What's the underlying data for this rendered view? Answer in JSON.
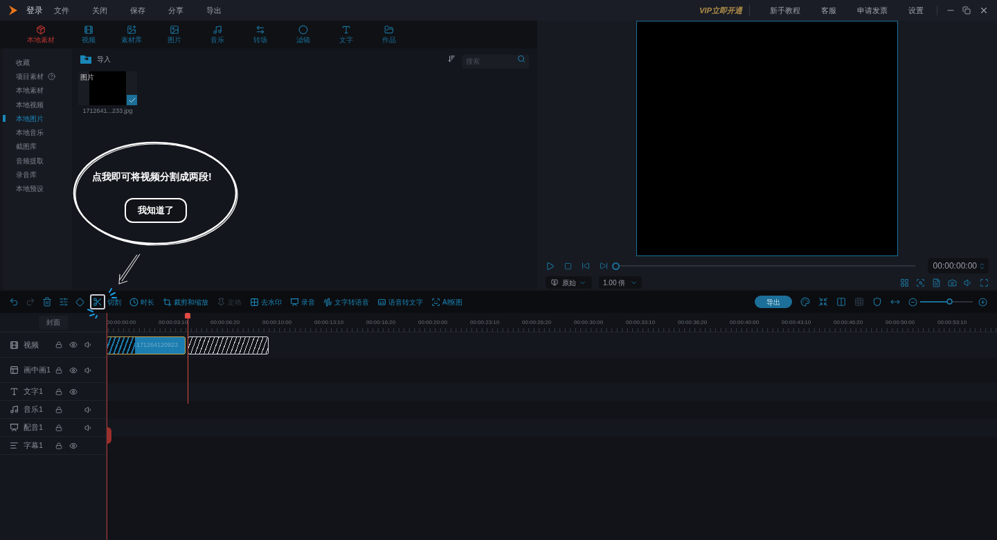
{
  "title_bar": {
    "login": "登录",
    "menu": [
      "文件",
      "关闭",
      "保存",
      "分享",
      "导出"
    ],
    "links": [
      {
        "label": "VIP立即开通",
        "kind": "vip"
      },
      {
        "label": "新手教程",
        "kind": "link"
      },
      {
        "label": "客服",
        "kind": "link"
      },
      {
        "label": "申请发票",
        "kind": "link"
      },
      {
        "label": "设置",
        "kind": "link"
      }
    ]
  },
  "media_tabs": [
    {
      "label": "本地素材",
      "kind": "box",
      "selected": true
    },
    {
      "label": "视频",
      "kind": "film",
      "selected": false
    },
    {
      "label": "素材库",
      "kind": "library",
      "selected": false
    },
    {
      "label": "图片",
      "kind": "image",
      "selected": false
    },
    {
      "label": "音乐",
      "kind": "music",
      "selected": false
    },
    {
      "label": "转场",
      "kind": "transition",
      "selected": false
    },
    {
      "label": "滤镜",
      "kind": "filter",
      "selected": false
    },
    {
      "label": "文字",
      "kind": "text",
      "selected": false
    },
    {
      "label": "作品",
      "kind": "folder",
      "selected": false
    }
  ],
  "sidebar": {
    "items": [
      {
        "label": "收藏",
        "help": false,
        "selected": false
      },
      {
        "label": "项目素材",
        "help": true,
        "selected": false
      },
      {
        "label": "本地素材",
        "help": false,
        "selected": false
      },
      {
        "label": "本地视频",
        "help": false,
        "selected": false
      },
      {
        "label": "本地图片",
        "help": false,
        "selected": true
      },
      {
        "label": "本地音乐",
        "help": false,
        "selected": false
      },
      {
        "label": "截图库",
        "help": false,
        "selected": false
      },
      {
        "label": "音频提取",
        "help": false,
        "selected": false
      },
      {
        "label": "录音库",
        "help": false,
        "selected": false
      },
      {
        "label": "本地预设",
        "help": false,
        "selected": false
      }
    ]
  },
  "library": {
    "import_label": "导入",
    "search": {
      "placeholder": "搜索"
    },
    "items": [
      {
        "badge": "图片",
        "filename": "1712641...233.jpg",
        "checked": true
      }
    ]
  },
  "tooltip": {
    "message": "点我即可将视频分割成两段!",
    "button": "我知道了"
  },
  "preview": {
    "progress": {
      "level": 0
    },
    "time": "00:00:00:00",
    "ratio": "原始",
    "speed": "1.00 倍"
  },
  "toolbar": {
    "tools": [
      {
        "label": "切割",
        "kind": "cut",
        "disabled": false,
        "highlighted": true
      },
      {
        "label": "时长",
        "kind": "clock",
        "disabled": false,
        "highlighted": false
      },
      {
        "label": "裁剪和缩放",
        "kind": "crop",
        "disabled": false,
        "highlighted": false
      },
      {
        "label": "定格",
        "kind": "freeze",
        "disabled": true,
        "highlighted": false
      },
      {
        "label": "去水印",
        "kind": "watermark",
        "disabled": false,
        "highlighted": false
      },
      {
        "label": "录音",
        "kind": "record",
        "disabled": false,
        "highlighted": false
      },
      {
        "label": "文字转语音",
        "kind": "tts",
        "disabled": false,
        "highlighted": false
      },
      {
        "label": "语音转文字",
        "kind": "stt",
        "disabled": false,
        "highlighted": false
      },
      {
        "label": "AI抠图",
        "kind": "ai",
        "disabled": false,
        "highlighted": false
      }
    ],
    "export": "导出",
    "zoom": {
      "level": 0.55
    }
  },
  "timeline": {
    "cover": "封面",
    "ticks": [
      "00:00:00:00",
      "00:00:03:10",
      "00:00:06:20",
      "00:00:10:00",
      "00:00:13:10",
      "00:00:16:20",
      "00:00:20:00",
      "00:00:23:10",
      "00:00:26:20",
      "00:00:30:00",
      "00:00:33:10",
      "00:00:36:20",
      "00:00:40:00",
      "00:00:43:10",
      "00:00:46:20",
      "00:00:50:00",
      "00:00:53:10"
    ],
    "tracks": [
      {
        "name": "视频",
        "kind": "film",
        "eye": true,
        "audio": true
      },
      {
        "name": "画中画1",
        "kind": "pip",
        "eye": true,
        "audio": true
      },
      {
        "name": "文字1",
        "kind": "text",
        "eye": true,
        "audio": false
      },
      {
        "name": "音乐1",
        "kind": "music",
        "eye": false,
        "audio": true
      },
      {
        "name": "配音1",
        "kind": "dub",
        "eye": false,
        "audio": true
      },
      {
        "name": "字幕1",
        "kind": "subtitle",
        "eye": true,
        "audio": false
      }
    ],
    "clips": [
      {
        "label": "171264120923",
        "kind": "clip"
      },
      {
        "kind": "ghost"
      }
    ]
  }
}
